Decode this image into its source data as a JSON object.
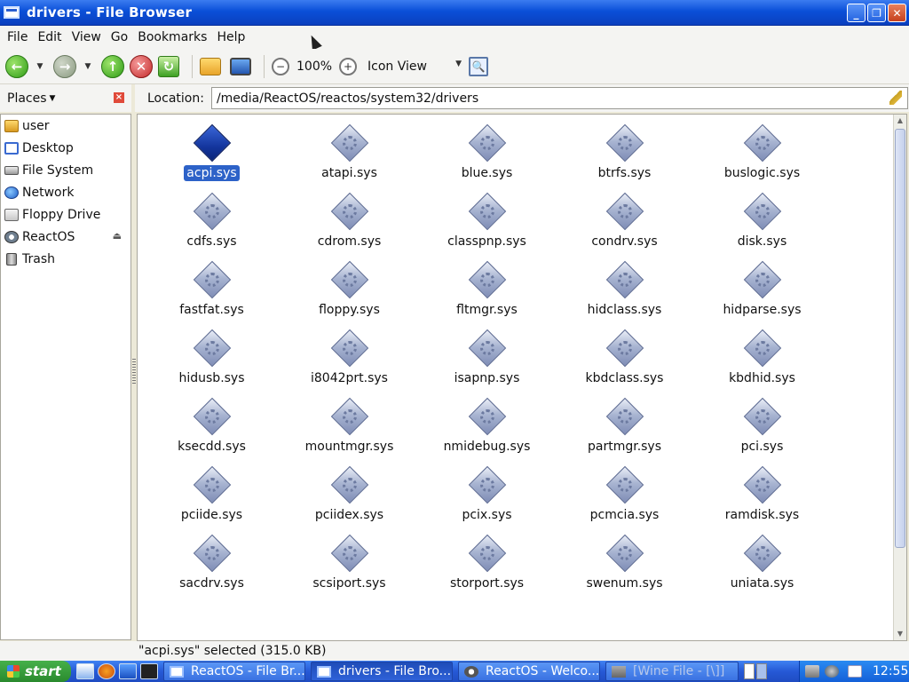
{
  "window": {
    "title": "drivers - File Browser"
  },
  "menu": [
    "File",
    "Edit",
    "View",
    "Go",
    "Bookmarks",
    "Help"
  ],
  "toolbar": {
    "zoom": "100%",
    "view_mode": "Icon View"
  },
  "places": {
    "label": "Places",
    "items": [
      {
        "label": "user",
        "icon": "folder-home-icon"
      },
      {
        "label": "Desktop",
        "icon": "desktop-icon"
      },
      {
        "label": "File System",
        "icon": "harddisk-icon"
      },
      {
        "label": "Network",
        "icon": "network-icon"
      },
      {
        "label": "Floppy Drive",
        "icon": "floppy-icon"
      },
      {
        "label": "ReactOS",
        "icon": "cdrom-icon"
      },
      {
        "label": "Trash",
        "icon": "trash-icon"
      }
    ]
  },
  "location": {
    "label": "Location:",
    "path": "/media/ReactOS/reactos/system32/drivers"
  },
  "files": [
    "acpi.sys",
    "atapi.sys",
    "blue.sys",
    "btrfs.sys",
    "buslogic.sys",
    "cdfs.sys",
    "cdrom.sys",
    "classpnp.sys",
    "condrv.sys",
    "disk.sys",
    "fastfat.sys",
    "floppy.sys",
    "fltmgr.sys",
    "hidclass.sys",
    "hidparse.sys",
    "hidusb.sys",
    "i8042prt.sys",
    "isapnp.sys",
    "kbdclass.sys",
    "kbdhid.sys",
    "ksecdd.sys",
    "mountmgr.sys",
    "nmidebug.sys",
    "partmgr.sys",
    "pci.sys",
    "pciide.sys",
    "pciidex.sys",
    "pcix.sys",
    "pcmcia.sys",
    "ramdisk.sys",
    "sacdrv.sys",
    "scsiport.sys",
    "storport.sys",
    "swenum.sys",
    "uniata.sys"
  ],
  "selected_file": "acpi.sys",
  "status": "\"acpi.sys\" selected (315.0 KB)",
  "taskbar": {
    "start": "start",
    "tasks": [
      {
        "label": "ReactOS - File Br...",
        "icon": "window-icon",
        "active": false
      },
      {
        "label": "drivers - File Bro...",
        "icon": "window-icon",
        "active": true
      },
      {
        "label": "ReactOS - Welco...",
        "icon": "reactos-icon",
        "active": false
      },
      {
        "label": "[Wine File - [\\]]",
        "icon": "wine-icon",
        "active": false
      }
    ],
    "clock": "12:55"
  }
}
